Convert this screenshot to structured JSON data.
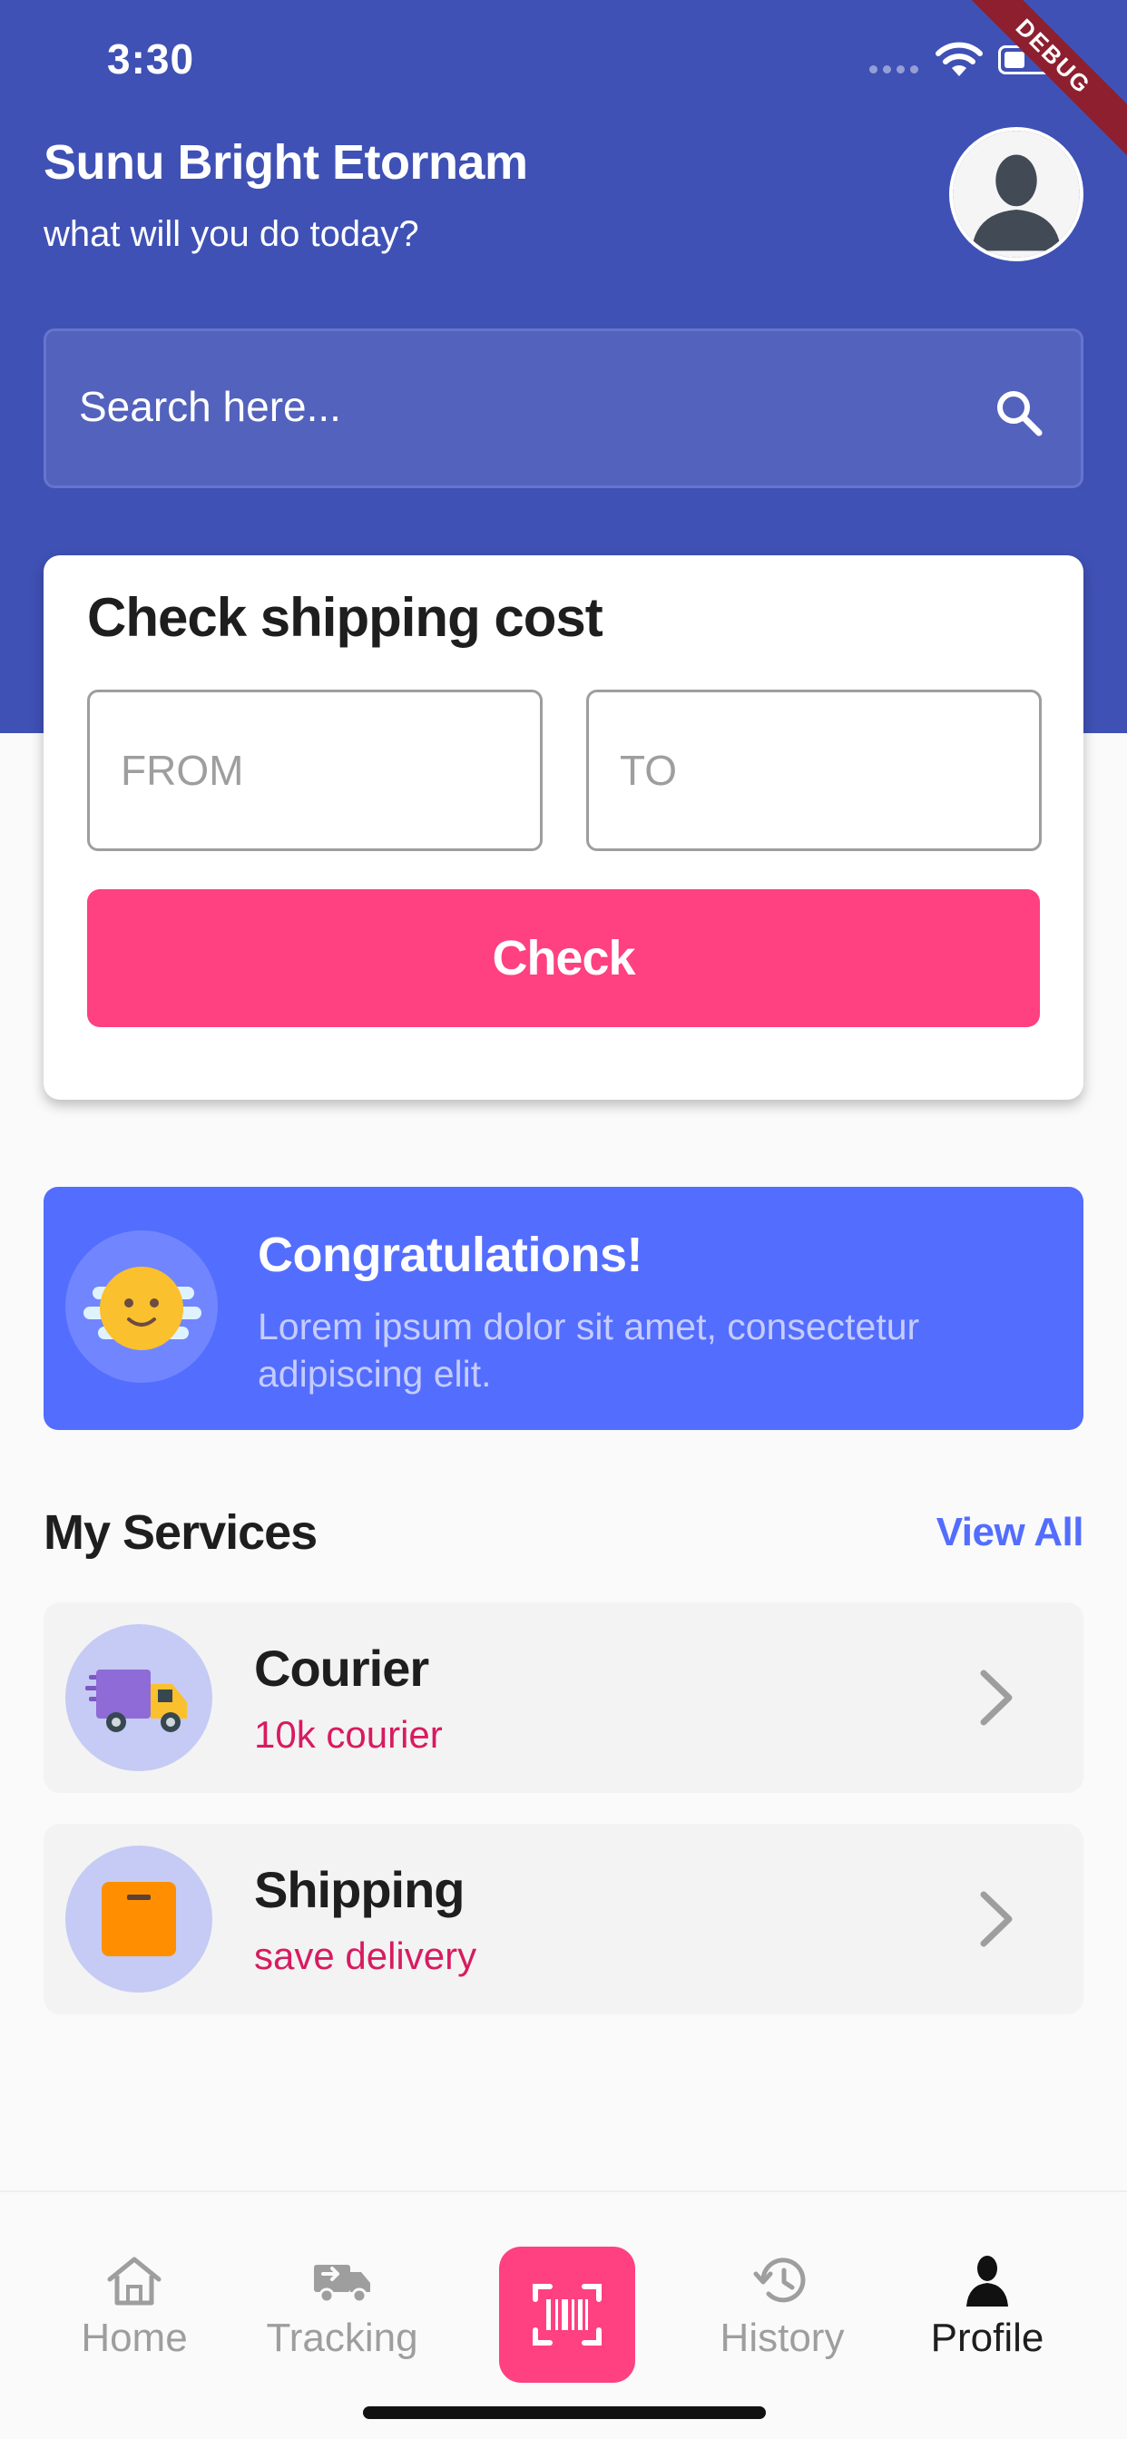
{
  "status_bar": {
    "time": "3:30",
    "debug_label": "DEBUG"
  },
  "header": {
    "user_name": "Sunu Bright Etornam",
    "greeting": "what will you do today?",
    "avatar_icon": "person-silhouette-icon"
  },
  "search": {
    "placeholder": "Search here...",
    "icon": "search-icon"
  },
  "shipping_card": {
    "title": "Check shipping cost",
    "from_placeholder": "FROM",
    "to_placeholder": "TO",
    "check_label": "Check"
  },
  "congrats": {
    "title": "Congratulations!",
    "text": "Lorem ipsum dolor sit amet, consectetur adipiscing elit.",
    "icon": "smiling-sun-icon"
  },
  "services": {
    "title": "My Services",
    "view_all": "View All",
    "items": [
      {
        "name": "Courier",
        "subtitle": "10k courier",
        "icon": "delivery-truck-icon"
      },
      {
        "name": "Shipping",
        "subtitle": "save delivery",
        "icon": "box-icon"
      }
    ]
  },
  "bottom_nav": {
    "items": [
      {
        "label": "Home",
        "icon": "home-icon"
      },
      {
        "label": "Tracking",
        "icon": "truck-icon"
      },
      {
        "label": "",
        "icon": "barcode-scan-icon"
      },
      {
        "label": "History",
        "icon": "history-icon"
      },
      {
        "label": "Profile",
        "icon": "person-icon",
        "active": true
      }
    ]
  },
  "colors": {
    "primary": "#3f51b5",
    "accent_pink": "#ff4081",
    "congrats_bg": "#536dfe",
    "subtitle_red": "#d81b60"
  }
}
